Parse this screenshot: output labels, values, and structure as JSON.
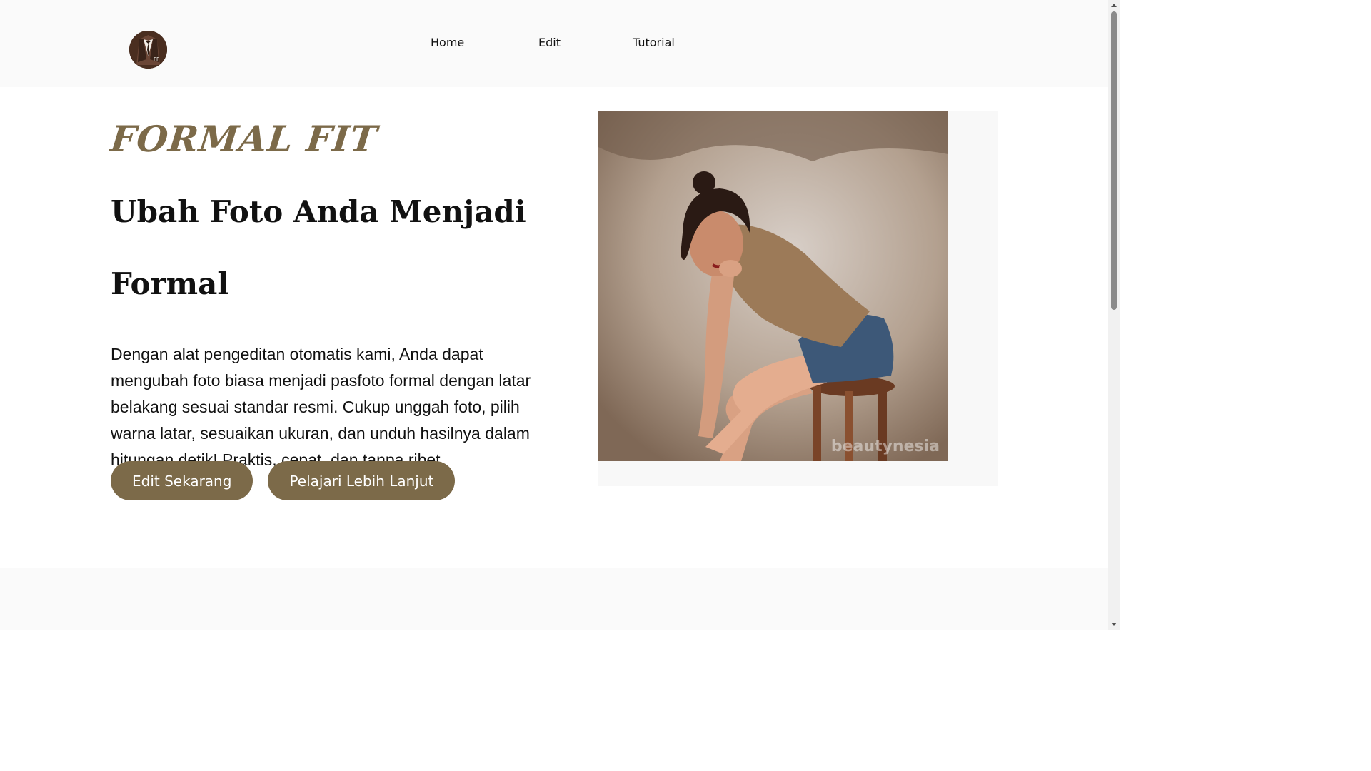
{
  "nav": {
    "logo_alt": "Formal Fit logo",
    "links": [
      {
        "label": "Home"
      },
      {
        "label": "Edit"
      },
      {
        "label": "Tutorial"
      }
    ]
  },
  "hero": {
    "brand": "FORMAL FIT",
    "headline_line1": "Ubah Foto Anda Menjadi",
    "headline_line2": "Formal",
    "description": "Dengan alat pengeditan otomatis kami, Anda dapat mengubah foto biasa menjadi pasfoto formal dengan latar belakang sesuai standar resmi. Cukup unggah foto, pilih warna latar, sesuaikan ukuran, dan unduh hasilnya dalam hitungan detik! Praktis, cepat, dan tanpa ribet.",
    "primary_button": "Edit Sekarang",
    "secondary_button": "Pelajari Lebih Lanjut"
  },
  "photo": {
    "watermark": "beautynesia"
  },
  "colors": {
    "accent": "#7c6a49",
    "nav_bg": "#fafafa",
    "text": "#111111"
  }
}
